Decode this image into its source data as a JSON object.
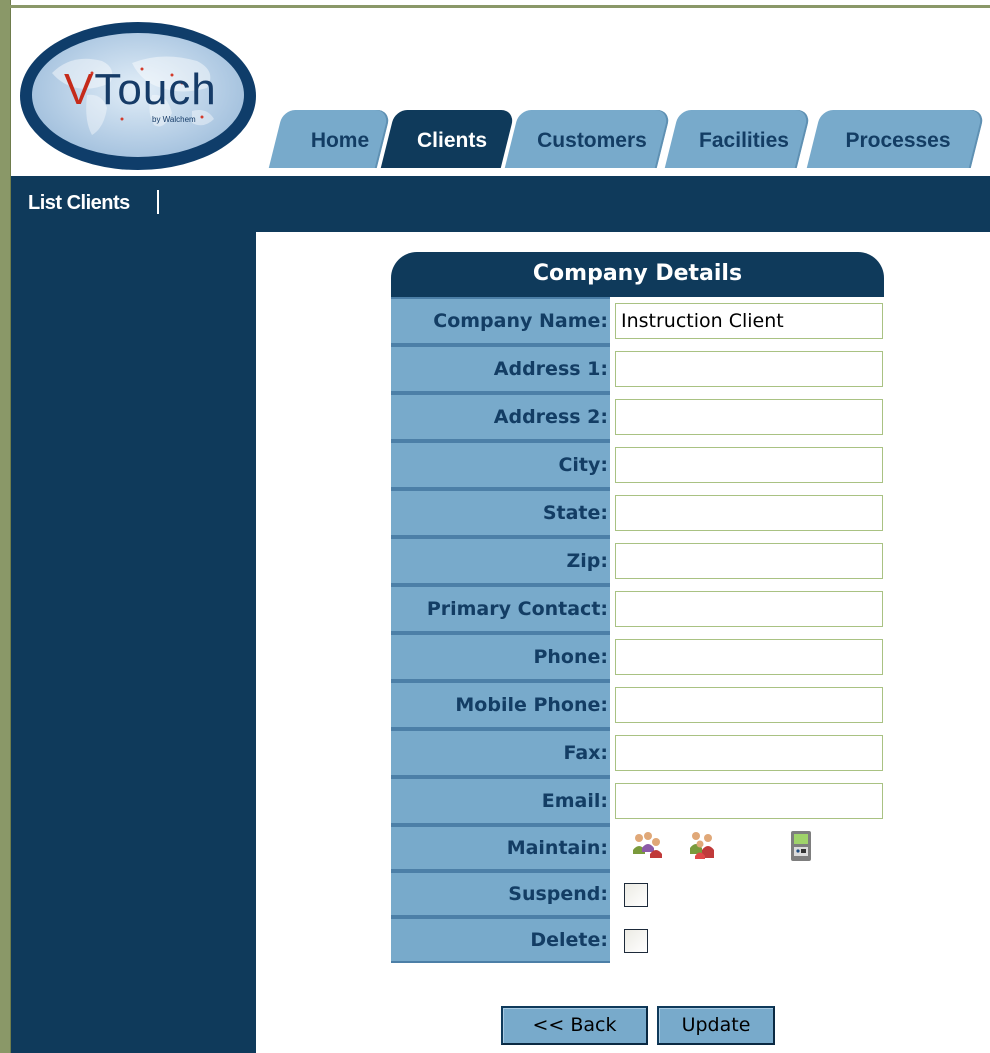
{
  "logo": {
    "text_initial": "V",
    "text_rest": "Touch",
    "subtitle": "by Walchem"
  },
  "tabs": [
    {
      "label": "Home",
      "active": false
    },
    {
      "label": "Clients",
      "active": true
    },
    {
      "label": "Customers",
      "active": false
    },
    {
      "label": "Facilities",
      "active": false
    },
    {
      "label": "Processes",
      "active": false
    }
  ],
  "subnav": {
    "link": "List Clients"
  },
  "form": {
    "title": "Company Details",
    "fields": [
      {
        "label": "Company Name:",
        "value": "Instruction Client"
      },
      {
        "label": "Address 1:",
        "value": ""
      },
      {
        "label": "Address 2:",
        "value": ""
      },
      {
        "label": "City:",
        "value": ""
      },
      {
        "label": "State:",
        "value": ""
      },
      {
        "label": "Zip:",
        "value": ""
      },
      {
        "label": "Primary Contact:",
        "value": ""
      },
      {
        "label": "Phone:",
        "value": ""
      },
      {
        "label": "Mobile Phone:",
        "value": ""
      },
      {
        "label": "Fax:",
        "value": ""
      },
      {
        "label": "Email:",
        "value": ""
      }
    ],
    "maintain": {
      "label": "Maintain:",
      "icons": [
        "users-icon",
        "user-group-icon",
        "controller-icon"
      ]
    },
    "suspend": {
      "label": "Suspend:",
      "checked": false
    },
    "delete": {
      "label": "Delete:",
      "checked": false
    }
  },
  "buttons": {
    "back": "<< Back",
    "update": "Update"
  },
  "colors": {
    "nav_dark": "#0f3a5b",
    "tab_light": "#78aacb",
    "label_text": "#133d64",
    "frame_green": "#8a9868",
    "field_border": "#a9c283"
  }
}
